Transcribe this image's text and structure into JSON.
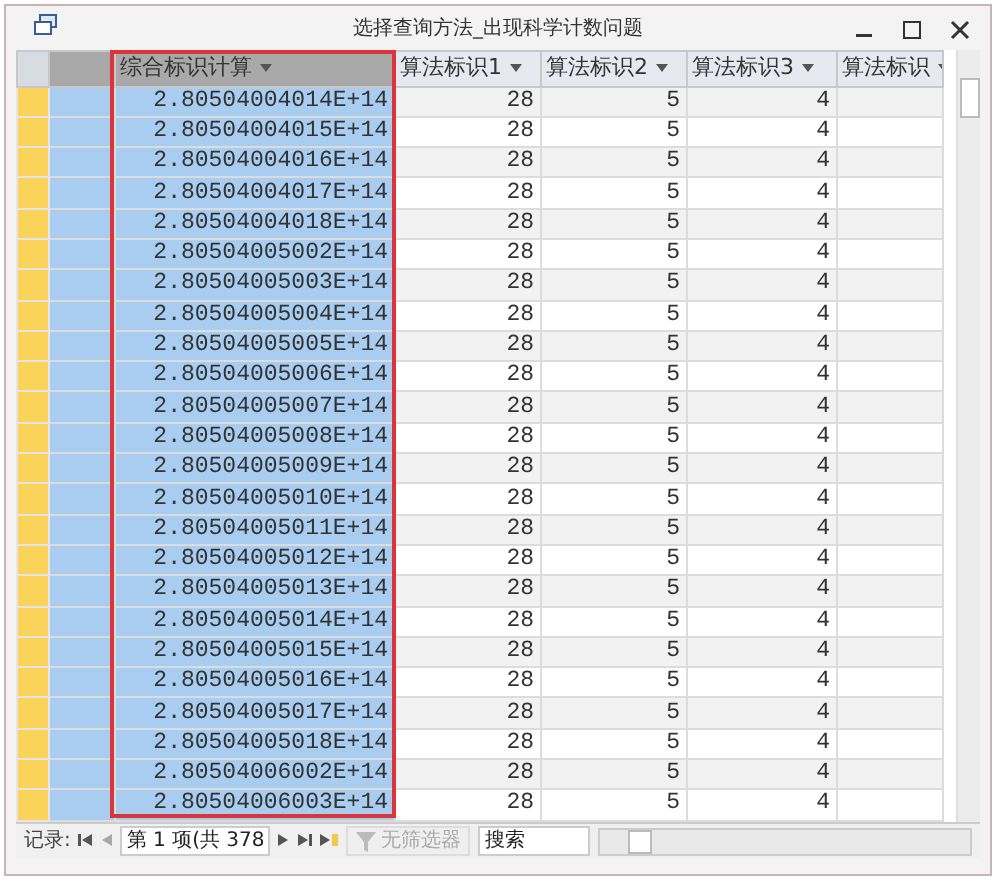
{
  "window": {
    "title": "选择查询方法_出现科学计数问题"
  },
  "table": {
    "columns": [
      {
        "selected": true
      },
      {
        "label": "综合标识计算",
        "selected": true,
        "framed": true
      },
      {
        "label": "算法标识1",
        "selected": false
      },
      {
        "label": "算法标识2",
        "selected": false
      },
      {
        "label": "算法标识3",
        "selected": false
      },
      {
        "label": "算法标识",
        "selected": false
      }
    ],
    "rows": [
      [
        "",
        "2.80504004014E+14",
        "28",
        "5",
        "4"
      ],
      [
        "",
        "2.80504004015E+14",
        "28",
        "5",
        "4"
      ],
      [
        "",
        "2.80504004016E+14",
        "28",
        "5",
        "4"
      ],
      [
        "",
        "2.80504004017E+14",
        "28",
        "5",
        "4"
      ],
      [
        "",
        "2.80504004018E+14",
        "28",
        "5",
        "4"
      ],
      [
        "",
        "2.80504005002E+14",
        "28",
        "5",
        "4"
      ],
      [
        "",
        "2.80504005003E+14",
        "28",
        "5",
        "4"
      ],
      [
        "",
        "2.80504005004E+14",
        "28",
        "5",
        "4"
      ],
      [
        "",
        "2.80504005005E+14",
        "28",
        "5",
        "4"
      ],
      [
        "",
        "2.80504005006E+14",
        "28",
        "5",
        "4"
      ],
      [
        "",
        "2.80504005007E+14",
        "28",
        "5",
        "4"
      ],
      [
        "",
        "2.80504005008E+14",
        "28",
        "5",
        "4"
      ],
      [
        "",
        "2.80504005009E+14",
        "28",
        "5",
        "4"
      ],
      [
        "",
        "2.80504005010E+14",
        "28",
        "5",
        "4"
      ],
      [
        "",
        "2.80504005011E+14",
        "28",
        "5",
        "4"
      ],
      [
        "",
        "2.80504005012E+14",
        "28",
        "5",
        "4"
      ],
      [
        "",
        "2.80504005013E+14",
        "28",
        "5",
        "4"
      ],
      [
        "",
        "2.80504005014E+14",
        "28",
        "5",
        "4"
      ],
      [
        "",
        "2.80504005015E+14",
        "28",
        "5",
        "4"
      ],
      [
        "",
        "2.80504005016E+14",
        "28",
        "5",
        "4"
      ],
      [
        "",
        "2.80504005017E+14",
        "28",
        "5",
        "4"
      ],
      [
        "",
        "2.80504005018E+14",
        "28",
        "5",
        "4"
      ],
      [
        "",
        "2.80504006002E+14",
        "28",
        "5",
        "4"
      ],
      [
        "",
        "2.80504006003E+14",
        "28",
        "5",
        "4"
      ]
    ]
  },
  "navigation": {
    "label": "记录:",
    "position": "第 1 项(共 378",
    "filter": {
      "label": "无筛选器",
      "disabled": true
    },
    "search": {
      "placeholder": "搜索"
    }
  }
}
